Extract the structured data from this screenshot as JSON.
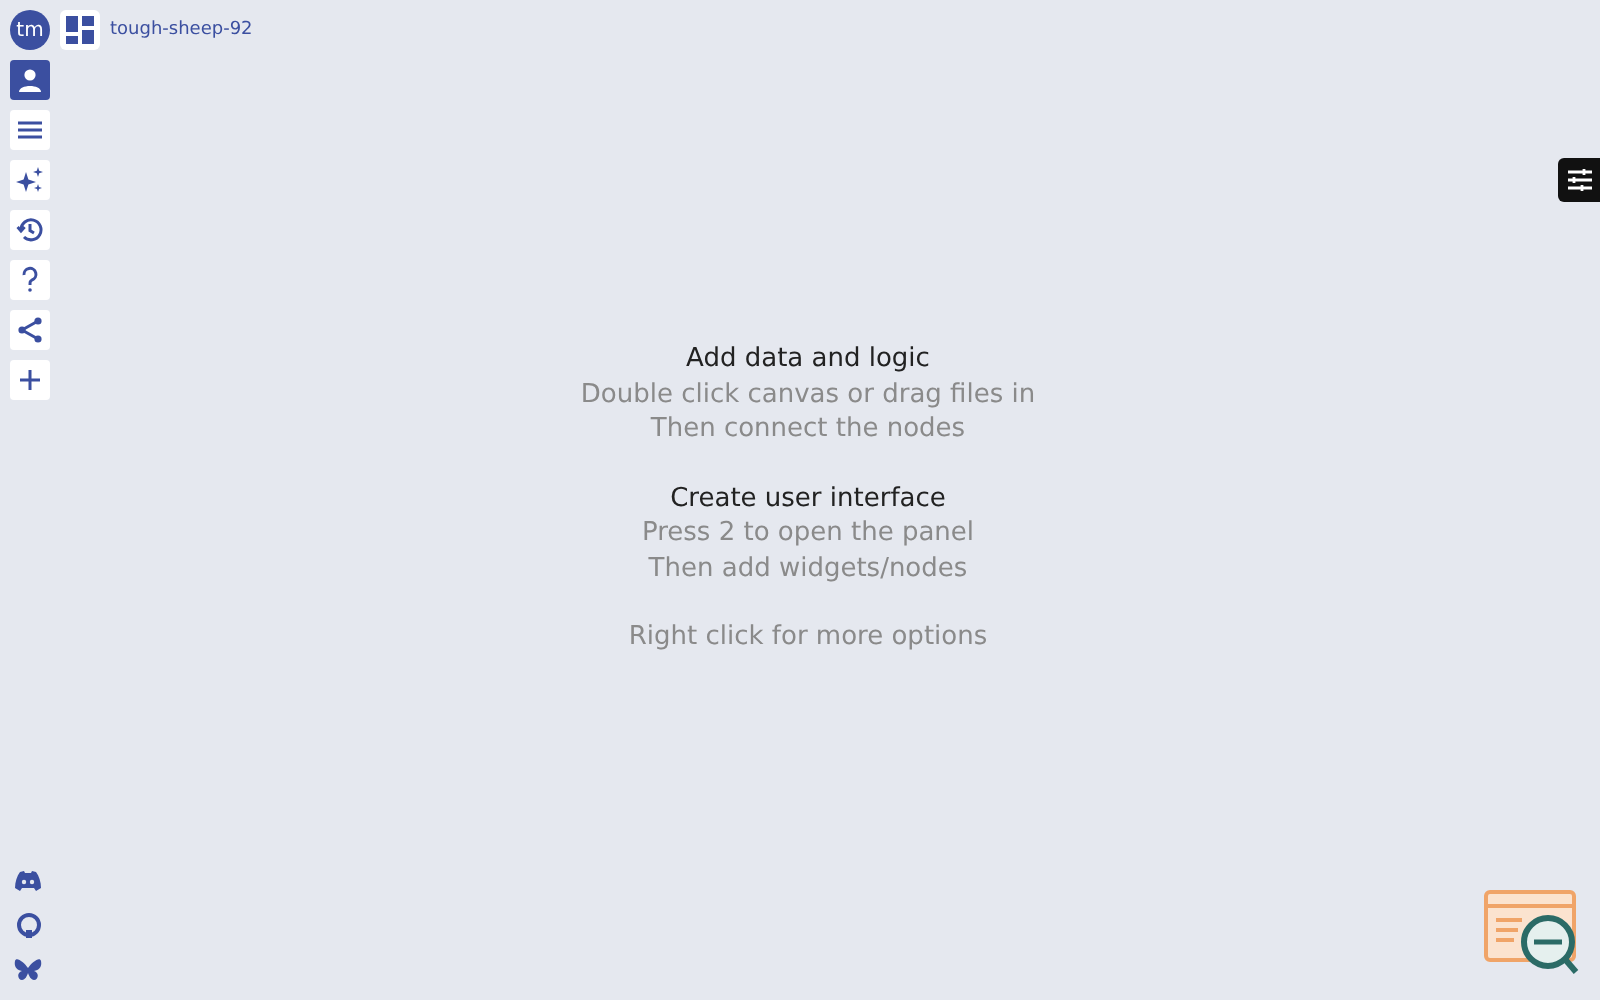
{
  "user": {
    "initials": "tm"
  },
  "project": {
    "name": "tough-sheep-92"
  },
  "tools": [
    {
      "kind": "user",
      "selected": true
    },
    {
      "kind": "menu",
      "selected": false
    },
    {
      "kind": "sparkles",
      "selected": false
    },
    {
      "kind": "history",
      "selected": false
    },
    {
      "kind": "help",
      "selected": false
    },
    {
      "kind": "share",
      "selected": false
    },
    {
      "kind": "add",
      "selected": false
    }
  ],
  "hints": [
    {
      "title": "Add data and logic",
      "lines": [
        "Double click canvas or drag files in",
        "Then connect the nodes"
      ]
    },
    {
      "title": "Create user interface",
      "lines": [
        "Press 2 to open the panel",
        "Then add widgets/nodes"
      ]
    },
    {
      "lines": [
        "Right click for more options"
      ]
    }
  ]
}
